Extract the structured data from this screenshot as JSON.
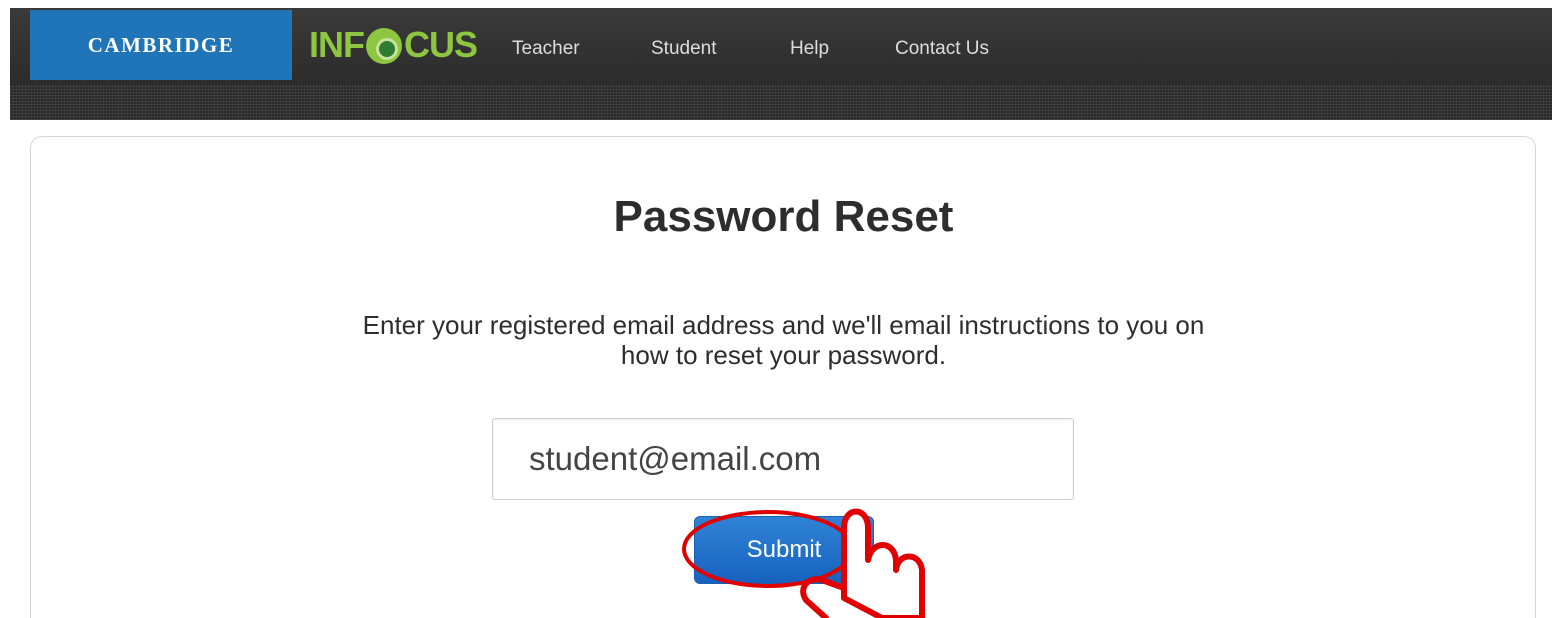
{
  "header": {
    "brand": "CAMBRIDGE",
    "product_logo": {
      "part1": "IN",
      "part2": "F",
      "part3": "CUS"
    },
    "nav": [
      {
        "label": "Teacher"
      },
      {
        "label": "Student"
      },
      {
        "label": "Help"
      },
      {
        "label": "Contact Us"
      }
    ]
  },
  "main": {
    "title": "Password Reset",
    "instructions_line1": "Enter your registered email address and we'll email instructions to you on",
    "instructions_line2": "how to reset your password.",
    "email_value": "student@email.com",
    "submit_label": "Submit"
  },
  "colors": {
    "brand_blue": "#1f75b8",
    "infocus_green": "#8dc63f",
    "button_blue": "#1762bf",
    "annotation_red": "#e00000"
  },
  "icons": {
    "pointer": "hand-pointer-icon"
  }
}
